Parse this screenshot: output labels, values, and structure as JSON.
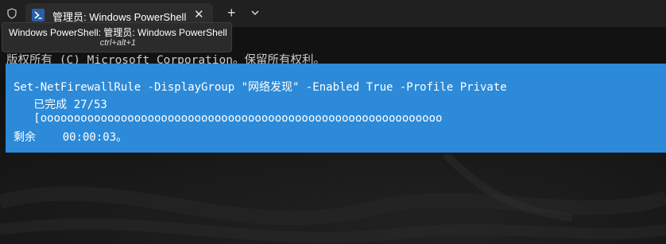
{
  "tab": {
    "title": "管理员: Windows PowerShell",
    "close_label": "✕",
    "icon": "powershell-icon"
  },
  "tabbar": {
    "new_tab_label": "+",
    "shield_icon": "shield-icon",
    "dropdown_icon": "chevron-down-icon"
  },
  "tooltip": {
    "title": "Windows PowerShell: 管理员: Windows PowerShell",
    "shortcut": "ctrl+alt+1"
  },
  "terminal": {
    "copyright_line": "版权所有 (C) Microsoft Corporation。保留所有权利。",
    "progress": {
      "command": "Set-NetFirewallRule -DisplayGroup \"网络发现\" -Enabled True -Profile Private",
      "status": "   已完成 27/53",
      "bar": "   [oooooooooooooooooooooooooooooooooooooooooooooooooooooooooooo",
      "remaining": "剩余    00:00:03。",
      "completed": 27,
      "total": 53
    }
  },
  "colors": {
    "progress_background": "#2c8ad8",
    "terminal_background": "#121212",
    "tabbar_background": "#202020"
  }
}
